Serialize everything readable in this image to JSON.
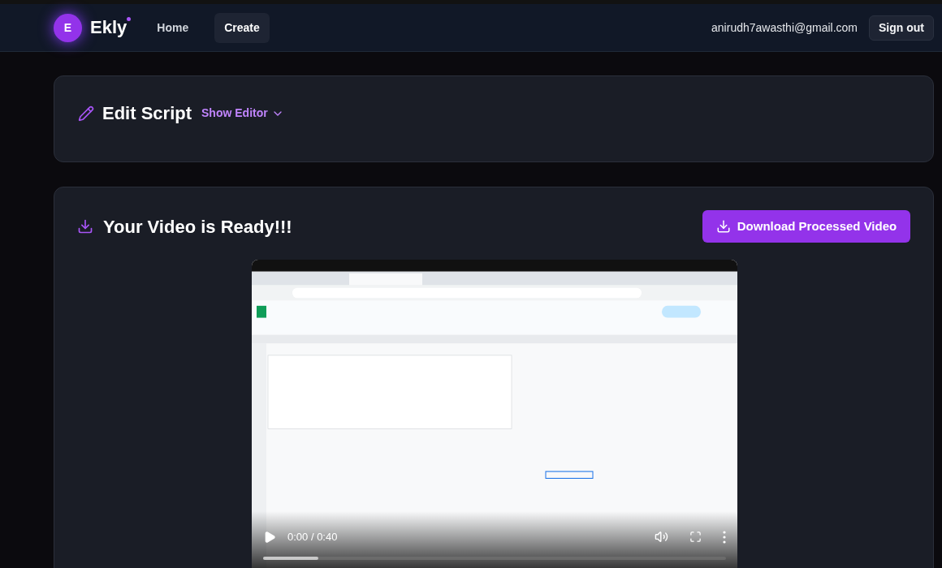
{
  "header": {
    "logo_letter": "E",
    "brand": "Ekly",
    "nav": [
      {
        "label": "Home",
        "selected": false
      },
      {
        "label": "Create",
        "selected": true
      }
    ],
    "email": "anirudh7awasthi@gmail.com",
    "sign_out": "Sign out"
  },
  "edit_script": {
    "title": "Edit Script",
    "toggle": "Show Editor"
  },
  "result": {
    "title": "Your Video is Ready!!!",
    "download": "Download Processed Video",
    "video": {
      "kind": "picture",
      "time": "0:00 / 0:40",
      "level": 0.12
    }
  }
}
